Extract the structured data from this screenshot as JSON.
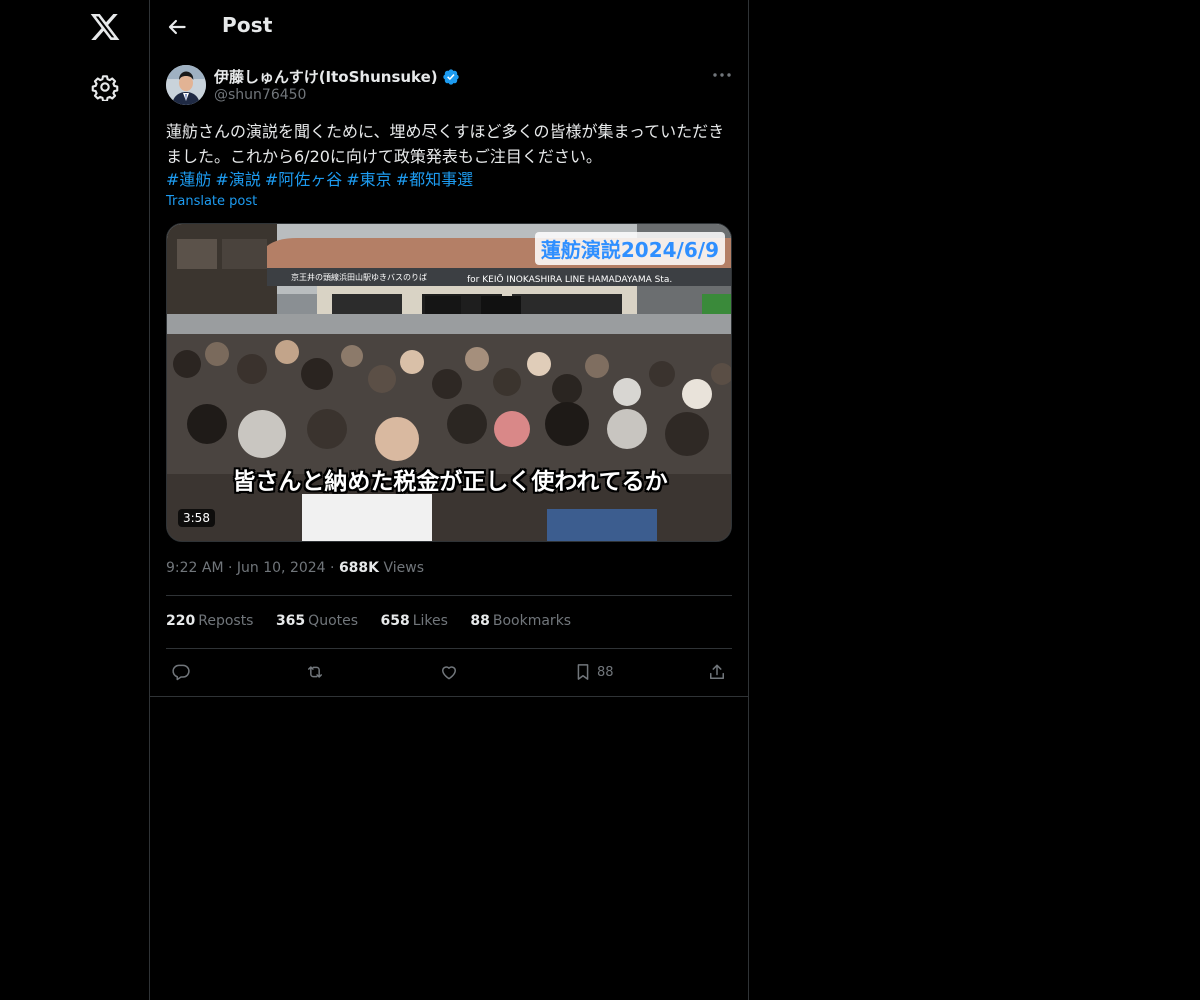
{
  "nav": {
    "logo_icon": "x-logo-icon",
    "settings_icon": "gear-icon"
  },
  "header": {
    "back_icon": "arrow-left-icon",
    "title": "Post"
  },
  "post": {
    "author": {
      "name": "伊藤しゅんすけ(ItoShunsuke)",
      "handle": "@shun76450",
      "verified": true
    },
    "text": "蓮舫さんの演説を聞くために、埋め尽くすほど多くの皆様が集まっていただきました。これから6/20に向けて政策発表もご注目ください。",
    "hashtags": [
      "#蓮舫",
      "#演説",
      "#阿佐ヶ谷",
      "#東京",
      "#都知事選"
    ],
    "translate_label": "Translate post",
    "media": {
      "overlay_title": "蓮舫演説2024/6/9",
      "caption": "皆さんと納めた税金が正しく使われてるか",
      "duration": "3:58",
      "bus_sign_left": "京王井の頭線浜田山駅ゆきバスのりば",
      "bus_sign_right": "for KEIŌ INOKASHIRA LINE HAMADAYAMA Sta."
    },
    "time": "9:22 AM",
    "date": "Jun 10, 2024",
    "views_count": "688K",
    "views_label": "Views",
    "stats": [
      {
        "count": "220",
        "label": "Reposts"
      },
      {
        "count": "365",
        "label": "Quotes"
      },
      {
        "count": "658",
        "label": "Likes"
      },
      {
        "count": "88",
        "label": "Bookmarks"
      }
    ],
    "actions": {
      "bookmark_count": "88"
    }
  },
  "colors": {
    "background": "#000000",
    "accent": "#1d9bf0",
    "muted_text": "#71767b",
    "primary_text": "#e7e9ea",
    "border": "#2f3336"
  }
}
